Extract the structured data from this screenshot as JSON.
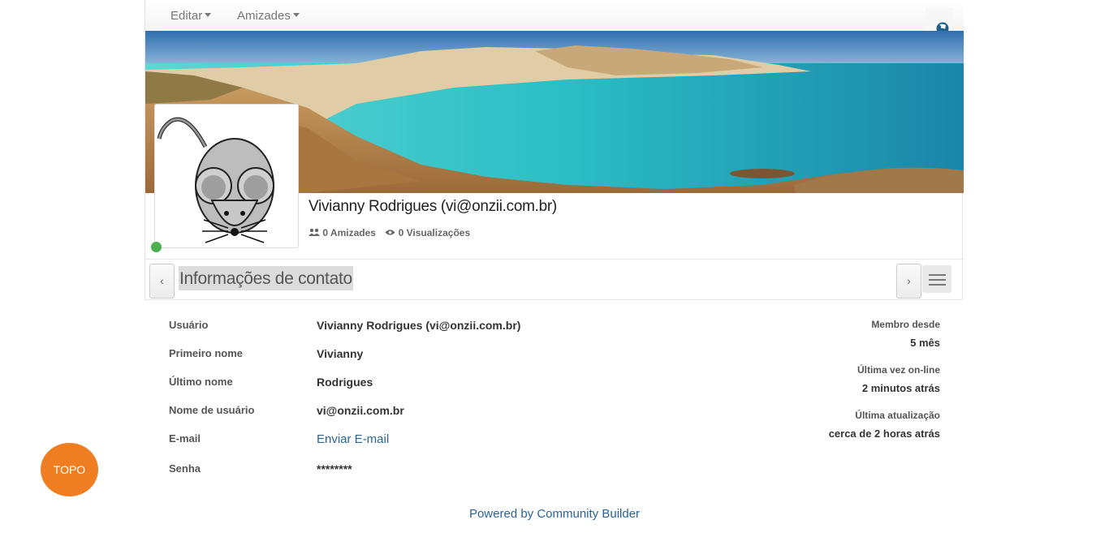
{
  "nav": {
    "edit_label": "Editar",
    "friends_label": "Amizades"
  },
  "profile": {
    "name": "Vivianny Rodrigues (vi@onzii.com.br)",
    "friends_count": "0 Amizades",
    "views_count": "0 Visualizações",
    "online": true
  },
  "tabs": {
    "active_label": "Informações de contato",
    "prev_icon": "‹",
    "next_icon": "›"
  },
  "fields": [
    {
      "label": "Usuário",
      "value": "Vivianny Rodrigues (vi@onzii.com.br)"
    },
    {
      "label": "Primeiro nome",
      "value": "Vivianny"
    },
    {
      "label": "Último nome",
      "value": "Rodrigues"
    },
    {
      "label": "Nome de usuário",
      "value": "vi@onzii.com.br"
    },
    {
      "label": "E-mail",
      "value": "Enviar E-mail"
    },
    {
      "label": "Senha",
      "value": "********"
    }
  ],
  "sidebar": {
    "member_since_label": "Membro desde",
    "member_since_value": "5 mês",
    "last_online_label": "Última vez on-line",
    "last_online_value": "2 minutos atrás",
    "last_update_label": "Última atualização",
    "last_update_value": "cerca de 2 horas atrás"
  },
  "topo_button": "TOPO",
  "footer": {
    "powered_by": "Powered by Community Builder"
  },
  "colors": {
    "link": "#2a6496",
    "topo": "#ef7e22",
    "online": "#4caf50"
  }
}
